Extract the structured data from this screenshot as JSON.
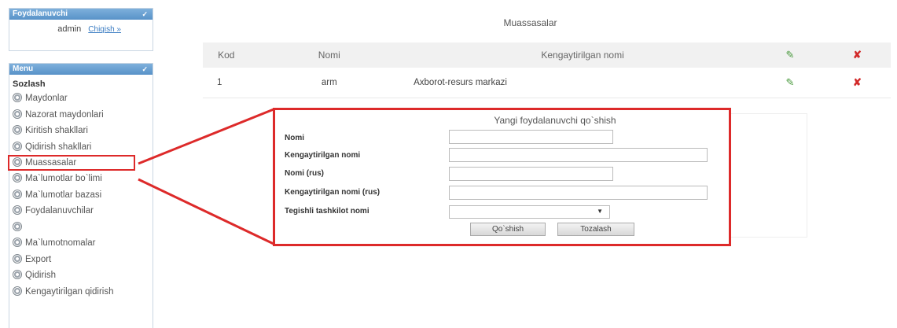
{
  "user_panel": {
    "title": "Foydalanuvchi",
    "username": "admin",
    "logout": "Chiqish »"
  },
  "menu": {
    "title": "Menu",
    "section": "Sozlash",
    "items": [
      "Maydonlar",
      "Nazorat maydonlari",
      "Kiritish shakllari",
      "Qidirish shakllari",
      "Muassasalar",
      "Ma`lumotlar bo`limi",
      "Ma`lumotlar bazasi",
      "Foydalanuvchilar",
      "",
      "Ma`lumotnomalar",
      "Export",
      "Qidirish",
      "Kengaytirilgan qidirish"
    ]
  },
  "main": {
    "title": "Muassasalar",
    "columns": [
      "Kod",
      "Nomi",
      "Kengaytirilgan nomi"
    ],
    "rows": [
      {
        "kod": "1",
        "nomi": "arm",
        "kengaytirilgan": "Axborot-resurs markazi"
      }
    ]
  },
  "form": {
    "title": "Yangi foydalanuvchi qo`shish",
    "labels": {
      "nomi": "Nomi",
      "kengaytirilgan": "Kengaytirilgan nomi",
      "nomi_rus": "Nomi (rus)",
      "kengaytirilgan_rus": "Kengaytirilgan nomi (rus)",
      "tashkilot": "Tegishli tashkilot nomi"
    },
    "select_value": "",
    "add_button": "Qo`shish",
    "clear_button": "Tozalash"
  },
  "colors": {
    "highlight": "#dd2a2a",
    "header_blue": "#5892c8"
  },
  "icons": {
    "edit": "edit-pencil-icon",
    "delete": "delete-x-icon",
    "menu": "gear-icon"
  }
}
